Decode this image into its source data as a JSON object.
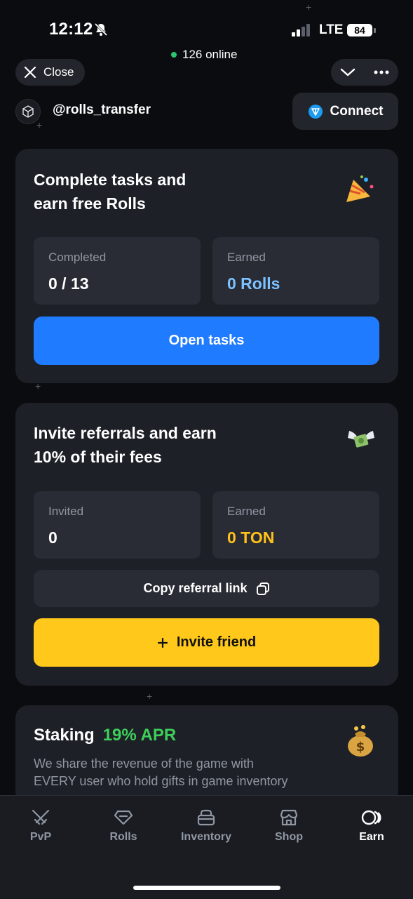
{
  "status_bar": {
    "time": "12:12",
    "network": "LTE",
    "battery": "84"
  },
  "header": {
    "online_text": "126 online",
    "close_label": "Close",
    "username": "@rolls_transfer",
    "connect_label": "Connect"
  },
  "tasks_card": {
    "title_line1": "Complete tasks and",
    "title_line2": "earn free Rolls",
    "completed_label": "Completed",
    "completed_value": "0 / 13",
    "earned_label": "Earned",
    "earned_value": "0 Rolls",
    "button_label": "Open tasks"
  },
  "referral_card": {
    "title_line1": "Invite referrals and earn",
    "title_line2": "10% of their fees",
    "invited_label": "Invited",
    "invited_value": "0",
    "earned_label": "Earned",
    "earned_value": "0 TON",
    "copy_label": "Copy referral link",
    "invite_label": "Invite friend"
  },
  "staking_card": {
    "title": "Staking",
    "apr": "19% APR",
    "description_line1": "We share the revenue of the game with",
    "description_line2": "EVERY user who hold gifts in game inventory"
  },
  "tabs": [
    {
      "label": "PvP",
      "icon": "swords-icon"
    },
    {
      "label": "Rolls",
      "icon": "gem-icon"
    },
    {
      "label": "Inventory",
      "icon": "box-icon"
    },
    {
      "label": "Shop",
      "icon": "store-icon"
    },
    {
      "label": "Earn",
      "icon": "earn-icon"
    }
  ],
  "colors": {
    "accent_blue": "#1f7bff",
    "accent_yellow": "#ffc81a",
    "rolls_blue": "#7cc2ff",
    "ton_yellow": "#ffc21a",
    "apr_green": "#3ecf5a",
    "online_green": "#28c76f"
  }
}
